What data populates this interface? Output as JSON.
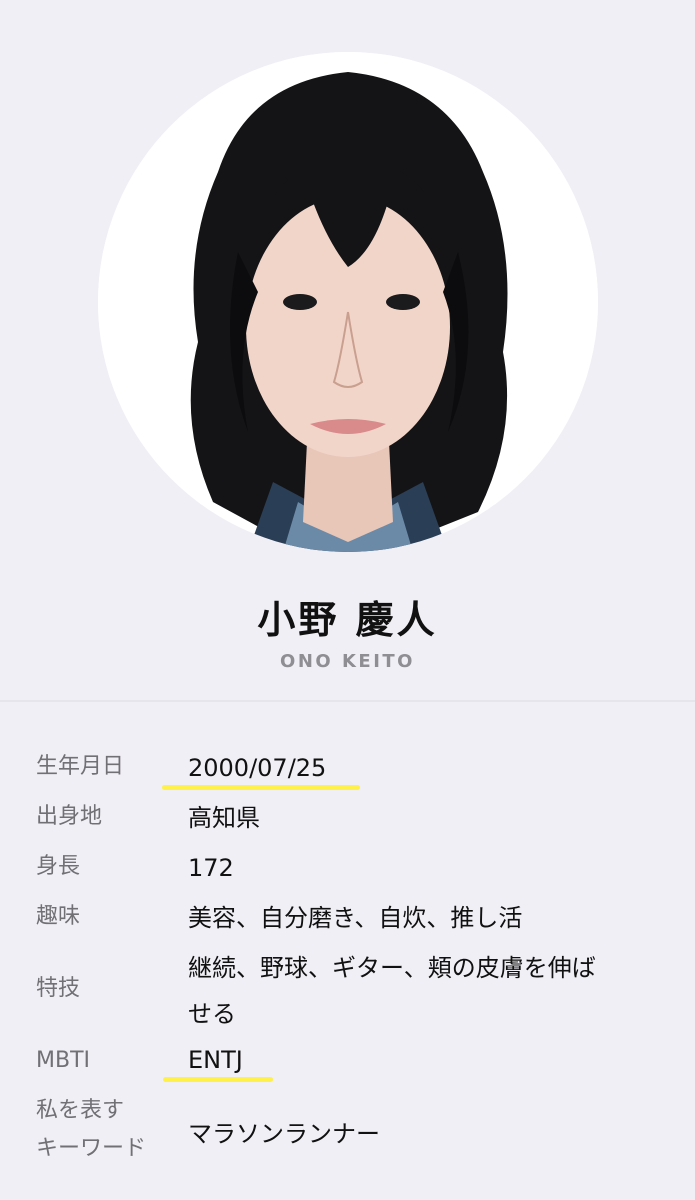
{
  "profile": {
    "name_ja": "小野 慶人",
    "name_en": "ONO KEITO",
    "accent_highlight": "#fff04a",
    "background": "#f0eff5"
  },
  "info": {
    "birthday": {
      "label": "生年月日",
      "value": "2000/07/25"
    },
    "hometown": {
      "label": "出身地",
      "value": "高知県"
    },
    "height": {
      "label": "身長",
      "value": "172"
    },
    "hobby": {
      "label": "趣味",
      "value": "美容、自分磨き、自炊、推し活"
    },
    "skill": {
      "label": "特技",
      "value_line1": "継続、野球、ギター、頬の皮膚を伸ば",
      "value_line2": "せる"
    },
    "mbti": {
      "label": "MBTI",
      "value": "ENTJ"
    },
    "keyword": {
      "label_line1": "私を表す",
      "label_line2": "キーワード",
      "value": "マラソンランナー"
    }
  }
}
